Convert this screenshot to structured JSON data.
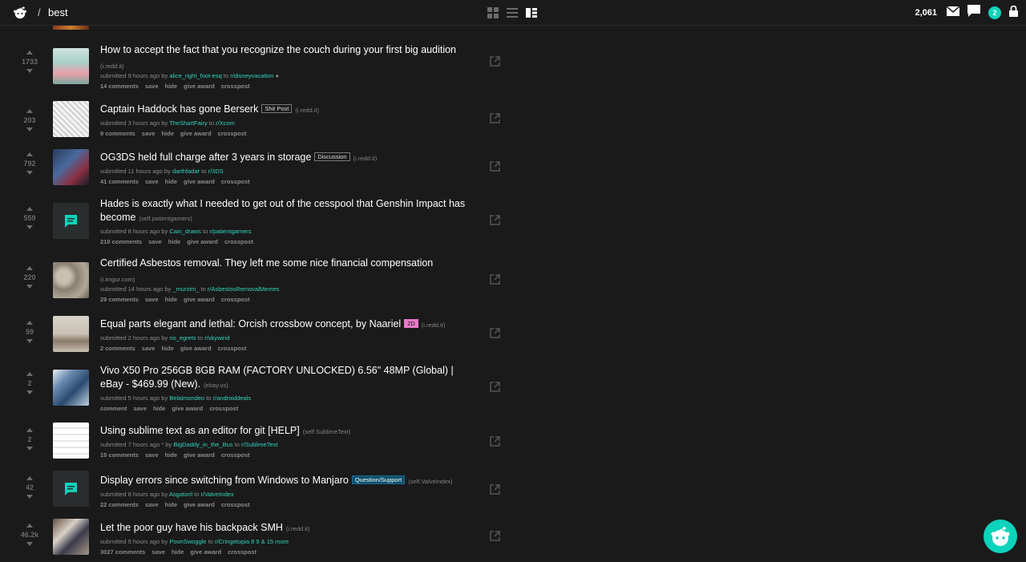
{
  "header": {
    "slash": "/",
    "subreddit": "best",
    "karma": "2,061",
    "chat_badge": "2"
  },
  "posts": [
    {
      "score": "1733",
      "title": "How to accept the fact that you recognize the couch during your first big audition",
      "domain": "(i.redd.it)",
      "submitted": "submitted 9 hours ago by",
      "user": "alice_right_foot-esq",
      "to": "to",
      "sub": "r/disneyvacation",
      "actions": [
        "14 comments",
        "save",
        "hide",
        "give award",
        "crosspost"
      ]
    },
    {
      "score": "203",
      "title": "Captain Haddock has gone Berserk",
      "flair": "Shit Post",
      "domain": "(i.redd.it)",
      "submitted": "submitted 3 hours ago by",
      "user": "TheShartFairy",
      "to": "to",
      "sub": "r/Xcom",
      "actions": [
        "9 comments",
        "save",
        "hide",
        "give award",
        "crosspost"
      ]
    },
    {
      "score": "792",
      "title": "OG3DS held full charge after 3 years in storage",
      "flair": "Discussion",
      "domain": "(i.redd.it)",
      "submitted": "submitted 11 hours ago by",
      "user": "darthfadar",
      "to": "to",
      "sub": "r/3DS",
      "actions": [
        "41 comments",
        "save",
        "hide",
        "give award",
        "crosspost"
      ]
    },
    {
      "score": "559",
      "title": "Hades is exactly what I needed to get out of the cesspool that Genshin Impact has become",
      "domain": "(self.patientgamers)",
      "submitted": "submitted 8 hours ago by",
      "user": "Cain_draws",
      "to": "to",
      "sub": "r/patientgamers",
      "actions": [
        "210 comments",
        "save",
        "hide",
        "give award",
        "crosspost"
      ]
    },
    {
      "score": "220",
      "title": "Certified Asbestos removal. They left me some nice financial compensation",
      "domain": "(i.imgur.com)",
      "submitted": "submitted 14 hours ago by",
      "user": "_murzim_",
      "to": "to",
      "sub": "r/AsbestosRemovalMemes",
      "actions": [
        "29 comments",
        "save",
        "hide",
        "give award",
        "crosspost"
      ]
    },
    {
      "score": "59",
      "title": "Equal parts elegant and lethal: Orcish crossbow concept, by Naariel",
      "flair": "2D",
      "domain": "(i.redd.it)",
      "submitted": "submitted 2 hours ago by",
      "user": "no_egrets",
      "to": "to",
      "sub": "r/skywind",
      "actions": [
        "2 comments",
        "save",
        "hide",
        "give award",
        "crosspost"
      ]
    },
    {
      "score": "2",
      "title": "Vivo X50 Pro 256GB 8GB RAM (FACTORY UNLOCKED) 6.56\" 48MP (Global) | eBay - $469.99 (New).",
      "domain": "(ebay.us)",
      "submitted": "submitted 5 hours ago by",
      "user": "Belalmondeo",
      "to": "to",
      "sub": "r/androiddeals",
      "actions": [
        "comment",
        "save",
        "hide",
        "give award",
        "crosspost"
      ]
    },
    {
      "score": "2",
      "title": "Using sublime text as an editor for git [HELP]",
      "domain": "(self.SublimeText)",
      "submitted": "submitted 7 hours ago * by",
      "user": "BigDaddy_in_the_Bus",
      "to": "to",
      "sub": "r/SublimeText",
      "actions": [
        "15 comments",
        "save",
        "hide",
        "give award",
        "crosspost"
      ]
    },
    {
      "score": "42",
      "title": "Display errors since switching from Windows to Manjaro",
      "flair": "Question/Support",
      "domain": "(self.ValveIndex)",
      "submitted": "submitted 8 hours ago by",
      "user": "Asgatoril",
      "to": "to",
      "sub": "r/ValveIndex",
      "actions": [
        "22 comments",
        "save",
        "hide",
        "give award",
        "crosspost"
      ]
    },
    {
      "score": "46.2k",
      "title": "Let the poor guy have his backpack SMH",
      "domain": "(i.redd.it)",
      "submitted": "submitted 9 hours ago by",
      "user": "PoonSwoggle",
      "to": "to",
      "sub": "r/Cringetopia",
      "extra": "8   9 & 15 more",
      "actions": [
        "3027 comments",
        "save",
        "hide",
        "give award",
        "crosspost"
      ]
    }
  ]
}
